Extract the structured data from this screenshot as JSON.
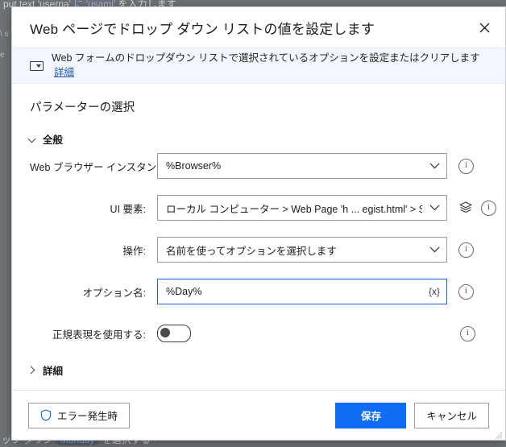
{
  "background": {
    "top_text_prefix": "put text 'userna' ",
    "top_text_kw": "に 'usami'",
    "top_text_suffix": " を入力します",
    "bottom_text_prefix": "ップ ダウン ",
    "bottom_text_pill": "Monday",
    "bottom_text_suffix": " を選択する",
    "left_edge_chars": "\\ s e",
    "right_edge_chars": "e"
  },
  "dialog": {
    "title": "Web ページでドロップ ダウン リストの値を設定します",
    "close_label": "×",
    "infobar": {
      "icon": "dropdown-list-icon",
      "description": "Web フォームのドロップダウン リストで選択されているオプションを設定またはクリアします",
      "link_label": "詳細"
    },
    "body": {
      "section_title": "パラメーターの選択",
      "groups": [
        {
          "label": "全般",
          "expanded": true,
          "chevron": "chevron-down-icon"
        },
        {
          "label": "詳細",
          "expanded": false,
          "chevron": "chevron-right-icon"
        }
      ],
      "fields": [
        {
          "name": "web-browser-instance",
          "label": "Web ブラウザー インスタンス:",
          "type": "dropdown",
          "value": "%Browser%",
          "has_caret": true,
          "has_info": true
        },
        {
          "name": "ui-element",
          "label": "UI 要素:",
          "type": "dropdown",
          "value": "ローカル コンピューター > Web Page 'h ... egist.html' > Select 'da",
          "has_caret": true,
          "has_layers": true,
          "has_info": true
        },
        {
          "name": "operation",
          "label": "操作:",
          "type": "dropdown",
          "value": "名前を使ってオプションを選択します",
          "has_caret": true,
          "has_info": true
        },
        {
          "name": "option-name",
          "label": "オプション名:",
          "type": "text",
          "value": "%Day%",
          "placeholder": "",
          "focused": true,
          "var_button": "{x}",
          "has_info": true
        },
        {
          "name": "use-regex",
          "label": "正規表現を使用する:",
          "type": "toggle",
          "checked": false,
          "has_info": true
        }
      ],
      "info_icon_label": "i"
    },
    "footer": {
      "on_error_label": "エラー発生時",
      "save_label": "保存",
      "cancel_label": "キャンセル"
    }
  },
  "colors": {
    "accent": "#0f6cf5",
    "link": "#1a57c4",
    "focus_border": "#1769d6",
    "infobar_bg": "#f3f6fd",
    "shield": "#1a6fd4"
  }
}
